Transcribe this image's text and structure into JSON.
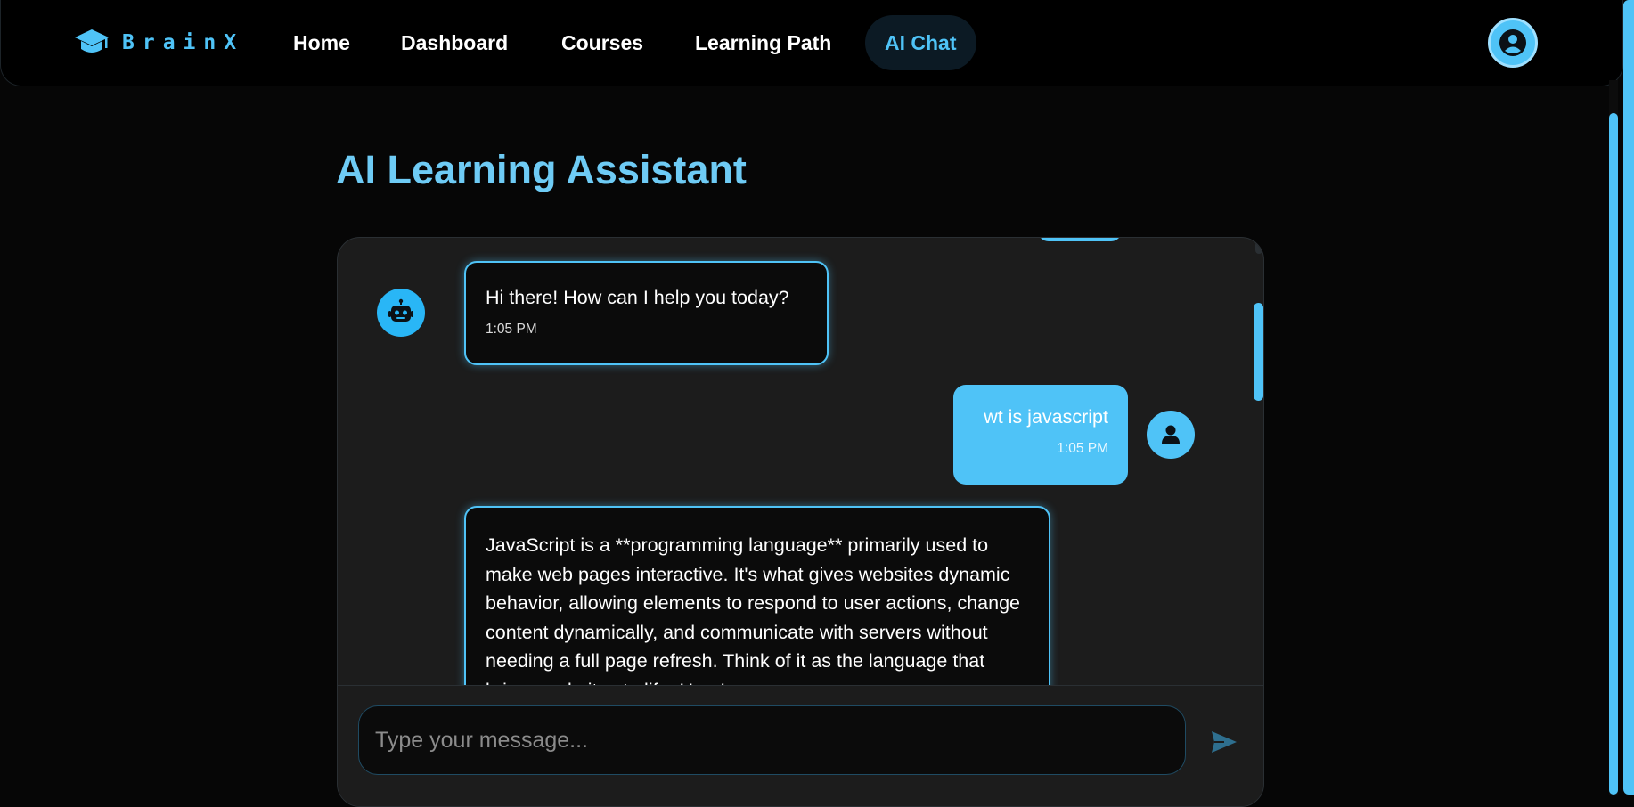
{
  "brand": {
    "name": "BrainX",
    "icon": "graduation-cap-icon"
  },
  "nav": {
    "items": [
      {
        "label": "Home",
        "active": false
      },
      {
        "label": "Dashboard",
        "active": false
      },
      {
        "label": "Courses",
        "active": false
      },
      {
        "label": "Learning Path",
        "active": false
      },
      {
        "label": "AI Chat",
        "active": true
      }
    ],
    "profile_icon": "user-circle-icon"
  },
  "page": {
    "title": "AI Learning Assistant"
  },
  "chat": {
    "messages": [
      {
        "role": "bot",
        "text": "Hi there! How can I help you today?",
        "time": "1:05 PM",
        "avatar_icon": "robot-icon"
      },
      {
        "role": "user",
        "text": "wt is javascript",
        "time": "1:05 PM",
        "avatar_icon": "user-icon"
      },
      {
        "role": "bot",
        "text": "JavaScript is a **programming language** primarily used to make web pages interactive. It's what gives websites dynamic behavior, allowing elements to respond to user actions, change content dynamically, and communicate with servers without needing a full page refresh. Think of it as the language that brings websites to life. Here's a",
        "time": "",
        "avatar_icon": ""
      }
    ],
    "input": {
      "placeholder": "Type your message...",
      "value": ""
    },
    "send_icon": "send-icon"
  },
  "colors": {
    "accent": "#4fc3f7",
    "title": "#6ecbf5",
    "background": "#060606",
    "card": "#1c1c1c"
  }
}
